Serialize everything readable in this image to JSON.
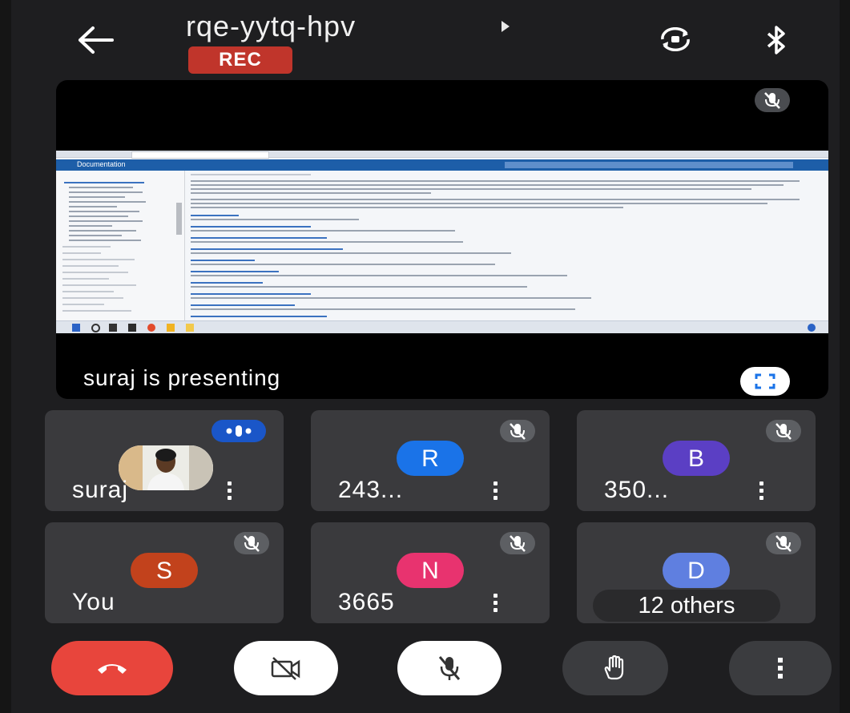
{
  "header": {
    "meeting_code": "rqe-yytq-hpv",
    "rec_label": "REC"
  },
  "presentation": {
    "presenting_text": "suraj is presenting",
    "shared_app_title": "Documentation"
  },
  "participants": [
    {
      "name": "suraj",
      "type": "photo",
      "speaking": true
    },
    {
      "name": "243...",
      "initial": "R",
      "color": "#1a73e8",
      "muted": true
    },
    {
      "name": "350...",
      "initial": "B",
      "color": "#5b3fc4",
      "muted": true
    },
    {
      "name": "You",
      "initial": "S",
      "color": "#c2421c",
      "muted": true
    },
    {
      "name": "3665",
      "initial": "N",
      "color": "#e8336f",
      "muted": true
    },
    {
      "name": "12 others",
      "initial": "D",
      "color": "#5f7fe0",
      "muted": true
    }
  ],
  "controls": [
    "end-call",
    "camera-off",
    "mic-off",
    "raise-hand",
    "more-options"
  ],
  "colors": {
    "background": "#1e1e20",
    "tile": "#3a3a3d",
    "rec": "#c0352b",
    "end_call": "#e8453c",
    "speaking": "#1a56c8"
  }
}
